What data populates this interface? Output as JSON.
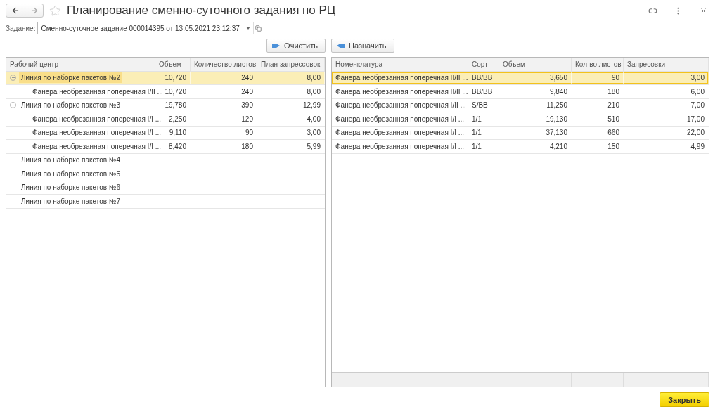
{
  "window": {
    "title": "Планирование сменно-суточного задания по РЦ",
    "favorite": false
  },
  "task_field": {
    "label": "Задание:",
    "value": "Сменно-суточное задание 000014395 от 13.05.2021 23:12:37"
  },
  "buttons": [
    {
      "label": "Очистить",
      "kind": "clear"
    },
    {
      "label": "Назначить",
      "kind": "assign"
    }
  ],
  "left_table": {
    "columns": [
      "Рабочий центр",
      "Объем",
      "Количество листов",
      "План запрессовок"
    ],
    "rows": [
      {
        "cells": [
          "Линия по наборке пакетов №2",
          "10,720",
          "240",
          "8,00"
        ],
        "selected": true,
        "expanded": true,
        "children": [
          {
            "cells": [
              "Фанера необрезанная поперечная I/II ...",
              "10,720",
              "240",
              "8,00"
            ],
            "selected": false
          }
        ]
      },
      {
        "cells": [
          "Линия по наборке пакетов №3",
          "19,780",
          "390",
          "12,99"
        ],
        "selected": false,
        "expanded": true,
        "children": [
          {
            "cells": [
              "Фанера необрезанная поперечная I/I ...",
              "2,250",
              "120",
              "4,00"
            ],
            "selected": false
          },
          {
            "cells": [
              "Фанера необрезанная поперечная I/I ...",
              "9,110",
              "90",
              "3,00"
            ],
            "selected": false
          },
          {
            "cells": [
              "Фанера необрезанная поперечная I/I ...",
              "8,420",
              "180",
              "5,99"
            ],
            "selected": false
          }
        ]
      },
      {
        "cells": [
          "Линия по наборке пакетов №4",
          "",
          "",
          ""
        ],
        "selected": false
      },
      {
        "cells": [
          "Линия по наборке пакетов №5",
          "",
          "",
          ""
        ],
        "selected": false
      },
      {
        "cells": [
          "Линия по наборке пакетов №6",
          "",
          "",
          ""
        ],
        "selected": false
      },
      {
        "cells": [
          "Линия по наборке пакетов №7",
          "",
          "",
          ""
        ],
        "selected": false
      }
    ]
  },
  "right_table": {
    "columns": [
      "Номенклатура",
      "Сорт",
      "Объем",
      "Кол-во листов",
      "Запресовки"
    ],
    "rows": [
      {
        "cells": [
          "Фанера необрезанная поперечная II/II ...",
          "BB/BB",
          "3,650",
          "90",
          "3,00"
        ],
        "selected": true
      },
      {
        "cells": [
          "Фанера необрезанная поперечная II/II ...",
          "BB/BB",
          "9,840",
          "180",
          "6,00"
        ],
        "selected": false
      },
      {
        "cells": [
          "Фанера необрезанная поперечная I/II ...",
          "S/BB",
          "11,250",
          "210",
          "7,00"
        ],
        "selected": false
      },
      {
        "cells": [
          "Фанера необрезанная поперечная I/I ...",
          "1/1",
          "19,130",
          "510",
          "17,00"
        ],
        "selected": false
      },
      {
        "cells": [
          "Фанера необрезанная поперечная I/I ...",
          "1/1",
          "37,130",
          "660",
          "22,00"
        ],
        "selected": false
      },
      {
        "cells": [
          "Фанера необрезанная поперечная I/I ...",
          "1/1",
          "4,210",
          "150",
          "4,99"
        ],
        "selected": false
      }
    ]
  },
  "close_button": {
    "label": "Закрыть"
  }
}
